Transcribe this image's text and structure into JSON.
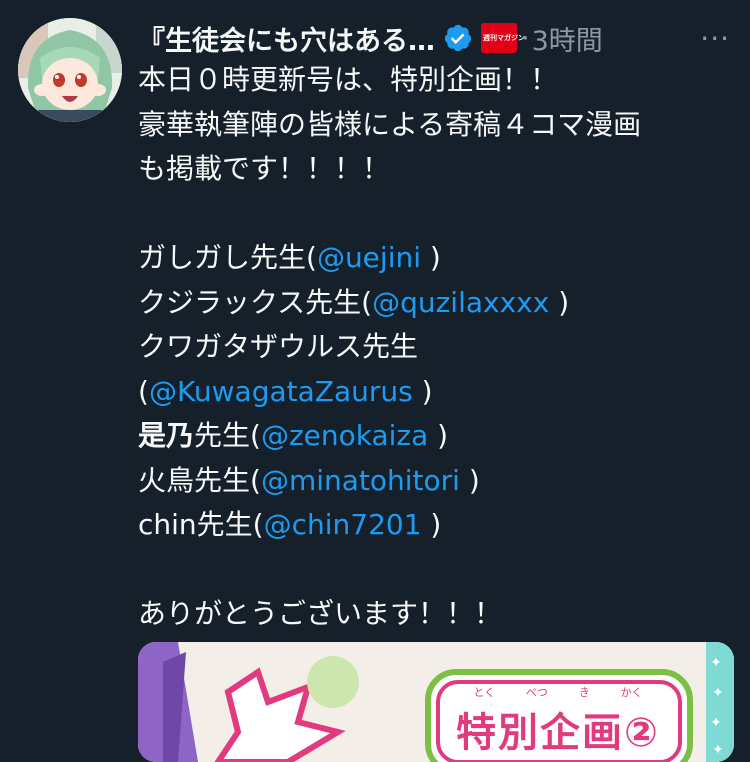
{
  "tweet": {
    "display_name": "『生徒会にも穴はある…",
    "publisher_badge": "週刊マガジン",
    "dot": "·",
    "time": "3時間",
    "more": "···",
    "lines": [
      {
        "parts": [
          {
            "text": "本日０時更新号は、特別企画！！"
          }
        ]
      },
      {
        "parts": [
          {
            "text": "豪華執筆陣の皆様による寄稿４コマ漫画"
          }
        ]
      },
      {
        "parts": [
          {
            "text": "も掲載です！！！！"
          }
        ]
      },
      {
        "parts": []
      },
      {
        "parts": [
          {
            "text": "ガしガし先生("
          },
          {
            "text": "@uejini",
            "mention": true
          },
          {
            "text": " )"
          }
        ]
      },
      {
        "parts": [
          {
            "text": "クジラックス先生("
          },
          {
            "text": "@quzilaxxxx",
            "mention": true
          },
          {
            "text": " )"
          }
        ]
      },
      {
        "parts": [
          {
            "text": "クワガタザウルス先生"
          }
        ]
      },
      {
        "parts": [
          {
            "text": "("
          },
          {
            "text": "@KuwagataZaurus",
            "mention": true
          },
          {
            "text": " )"
          }
        ]
      },
      {
        "parts": [
          {
            "text": "是乃",
            "bold": true
          },
          {
            "text": "先生("
          },
          {
            "text": "@zenokaiza",
            "mention": true
          },
          {
            "text": " )"
          }
        ]
      },
      {
        "parts": [
          {
            "text": "火鳥先生("
          },
          {
            "text": "@minatohitori",
            "mention": true
          },
          {
            "text": " )"
          }
        ]
      },
      {
        "parts": [
          {
            "text": "chin先生("
          },
          {
            "text": "@chin7201",
            "mention": true
          },
          {
            "text": " )"
          }
        ]
      },
      {
        "parts": []
      },
      {
        "parts": [
          {
            "text": "ありがとうございます！！！"
          }
        ]
      }
    ],
    "media": {
      "banner_text": "特別企画②",
      "furigana": [
        "とく",
        "べつ",
        "き",
        "かく"
      ]
    }
  },
  "colors": {
    "background": "#15202b",
    "text": "#f7f9f9",
    "secondary": "#8b98a5",
    "mention": "#1d9bf0",
    "verified": "#1d9bf0",
    "badge": "#e10018"
  }
}
